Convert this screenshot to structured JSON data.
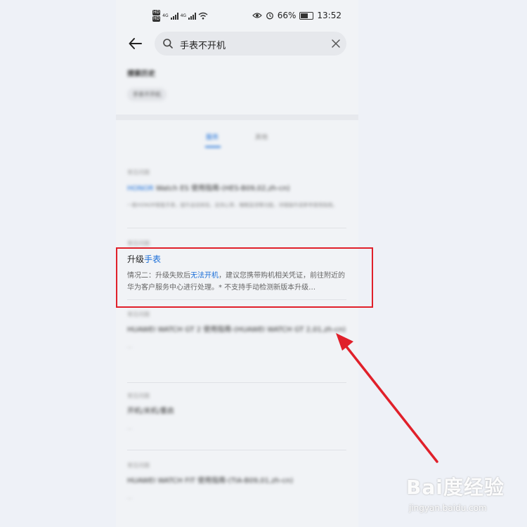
{
  "status_bar": {
    "network_a": "4G",
    "network_b": "4G",
    "battery_percent": "66%",
    "time": "13:52",
    "icons": [
      "hd-icon",
      "signal-icon",
      "wifi-icon",
      "eye-icon",
      "alarm-icon",
      "battery-icon"
    ]
  },
  "search": {
    "query": "手表不开机",
    "icons": [
      "back-arrow-icon",
      "search-icon",
      "close-icon"
    ]
  },
  "history": {
    "title": "搜索历史",
    "chips": [
      "手表不开机"
    ]
  },
  "tabs": [
    {
      "label": "服务",
      "active": true
    },
    {
      "label": "其他",
      "active": false
    }
  ],
  "results": [
    {
      "section": "常见问题",
      "title_plain": "HONOR",
      "title_rest": " Watch ES 使用指南-(HES-B09,02,zh-cn)",
      "desc": "一款HONOR智能手表，提升运动体验，支持心率、睡眠监测等功能，详细操作请参考使用指南。"
    }
  ],
  "focus_item": {
    "section": "常见问题",
    "title_prefix": "升级",
    "title_highlight": "手表",
    "desc_prefix": "情况二：升级失败后",
    "desc_highlight": "无法开机",
    "desc_suffix": "，建议您携带购机相关凭证，前往附近的华为客户服务中心进行处理。* 不支持手动检测新版本升级…"
  },
  "more_results": [
    {
      "section": "常见问题",
      "title": "HUAWEI WATCH GT 2 使用指南-(HUAWEI WATCH GT 2,01,zh-cn)",
      "desc": "…"
    },
    {
      "section": "常见问题",
      "title": "开机/关机/重启",
      "desc": "…"
    },
    {
      "section": "常见问题",
      "title": "HUAWEI WATCH FIT 使用指南-(TIA-B09,01,zh-cn)",
      "desc": "…"
    }
  ],
  "watermark": {
    "brand": "Bai度经验",
    "url": "jingyan.baidu.com"
  },
  "colors": {
    "accent": "#1a6ed8",
    "annotation_red": "#e0202a"
  }
}
